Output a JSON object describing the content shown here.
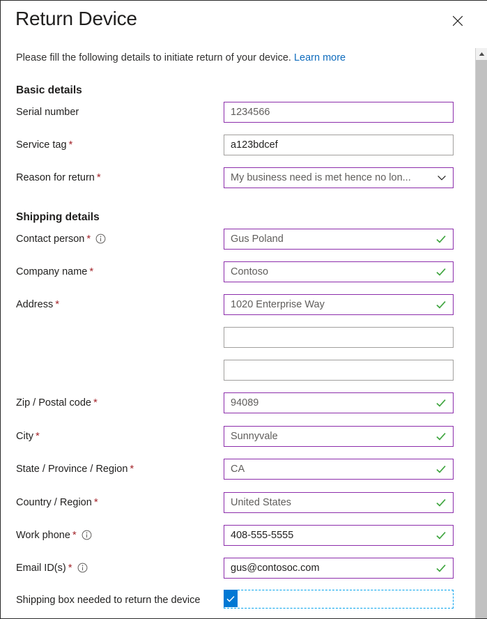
{
  "dialog": {
    "title": "Return Device",
    "close_icon": "close-icon",
    "intro_text": "Please fill the following details to initiate return of your device.",
    "learn_more_label": "Learn more"
  },
  "sections": {
    "basic": {
      "heading": "Basic details"
    },
    "shipping": {
      "heading": "Shipping details"
    }
  },
  "fields": {
    "serial_number": {
      "label": "Serial number",
      "required": false,
      "value": "1234566",
      "placeholder": "",
      "border": "accent",
      "validated": false,
      "info": false
    },
    "service_tag": {
      "label": "Service tag",
      "required": true,
      "value": "a123bdcef",
      "placeholder": "",
      "border": "default",
      "validated": false,
      "info": false
    },
    "reason_for_return": {
      "label": "Reason for return",
      "required": true,
      "value": "My business need is met hence no lon...",
      "placeholder": "",
      "border": "accent",
      "type": "dropdown",
      "chevron_icon": "chevron-down-icon"
    },
    "contact_person": {
      "label": "Contact person",
      "required": true,
      "value": "Gus Poland",
      "placeholder": "",
      "border": "accent",
      "validated": true,
      "info": true,
      "info_icon": "info-icon"
    },
    "company_name": {
      "label": "Company name",
      "required": true,
      "value": "Contoso",
      "placeholder": "",
      "border": "accent",
      "validated": true,
      "info": false
    },
    "address_line1": {
      "label": "Address",
      "required": true,
      "value": "1020 Enterprise Way",
      "placeholder": "",
      "border": "accent",
      "validated": true,
      "info": false
    },
    "address_line2": {
      "label": "",
      "required": false,
      "value": "",
      "placeholder": "",
      "border": "default",
      "validated": false,
      "info": false
    },
    "address_line3": {
      "label": "",
      "required": false,
      "value": "",
      "placeholder": "",
      "border": "default",
      "validated": false,
      "info": false
    },
    "zip_postal_code": {
      "label": "Zip / Postal code",
      "required": true,
      "value": "94089",
      "placeholder": "",
      "border": "accent",
      "validated": true,
      "info": false
    },
    "city": {
      "label": "City",
      "required": true,
      "value": "Sunnyvale",
      "placeholder": "",
      "border": "accent",
      "validated": true,
      "info": false
    },
    "state_province_region": {
      "label": "State / Province / Region",
      "required": true,
      "value": "CA",
      "placeholder": "",
      "border": "accent",
      "validated": true,
      "info": false
    },
    "country_region": {
      "label": "Country / Region",
      "required": true,
      "value": "United States",
      "placeholder": "",
      "border": "accent",
      "validated": true,
      "info": false
    },
    "work_phone": {
      "label": "Work phone",
      "required": true,
      "value": "408-555-5555",
      "placeholder": "",
      "border": "accent",
      "validated": true,
      "info": true,
      "info_icon": "info-icon"
    },
    "email_ids": {
      "label": "Email ID(s)",
      "required": true,
      "value": "gus@contosoc.com",
      "placeholder": "",
      "border": "accent",
      "validated": true,
      "info": true,
      "info_icon": "info-icon"
    }
  },
  "checkbox": {
    "label": "Shipping box needed to return the device",
    "checked": true,
    "icon": "checkmark-icon"
  },
  "scrollbar": {
    "up_arrow_icon": "caret-up-icon"
  },
  "required_marker": "*",
  "colors": {
    "accent_border": "#8c2dab",
    "default_border": "#a19f9d",
    "link": "#0f6cbd",
    "required_asterisk": "#a4262c",
    "validated_check": "#3fa53f",
    "checkbox_fill": "#0078d4",
    "focus_outline": "#00a2ed",
    "text_primary": "#201f1e",
    "text_secondary": "#605e5c"
  }
}
